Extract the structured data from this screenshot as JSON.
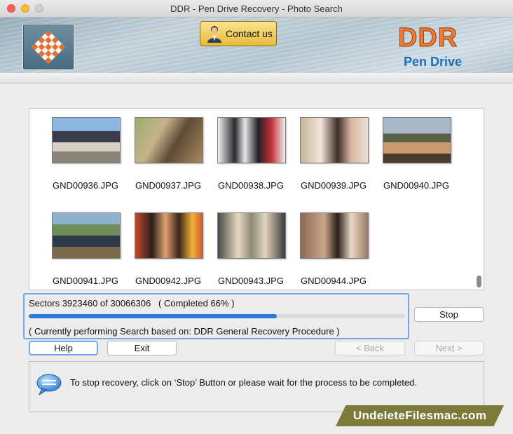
{
  "window": {
    "title": "DDR - Pen Drive Recovery - Photo Search"
  },
  "header": {
    "contact_label": "Contact us",
    "brand_main": "DDR",
    "brand_sub": "Pen Drive",
    "brand_color": "#f07a32",
    "brand_sub_color": "#1b6fb8"
  },
  "gallery": {
    "items": [
      {
        "filename": "GND00936.JPG"
      },
      {
        "filename": "GND00937.JPG"
      },
      {
        "filename": "GND00938.JPG"
      },
      {
        "filename": "GND00939.JPG"
      },
      {
        "filename": "GND00940.JPG"
      },
      {
        "filename": "GND00941.JPG"
      },
      {
        "filename": "GND00942.JPG"
      },
      {
        "filename": "GND00943.JPG"
      },
      {
        "filename": "GND00944.JPG"
      }
    ]
  },
  "progress": {
    "sectors_text": "Sectors 3923460 of 30066306   ( Completed 66% )",
    "fraction": 0.66,
    "status_text": "( Currently performing Search based on: DDR General Recovery Procedure )",
    "accent": "#2e78dc"
  },
  "buttons": {
    "stop": "Stop",
    "help": "Help",
    "exit": "Exit",
    "back": "< Back",
    "next": "Next >"
  },
  "info": {
    "message": "To stop recovery, click on ‘Stop’ Button or please wait for the process to be completed."
  },
  "watermark": {
    "text": "UndeleteFilesmac.com"
  }
}
